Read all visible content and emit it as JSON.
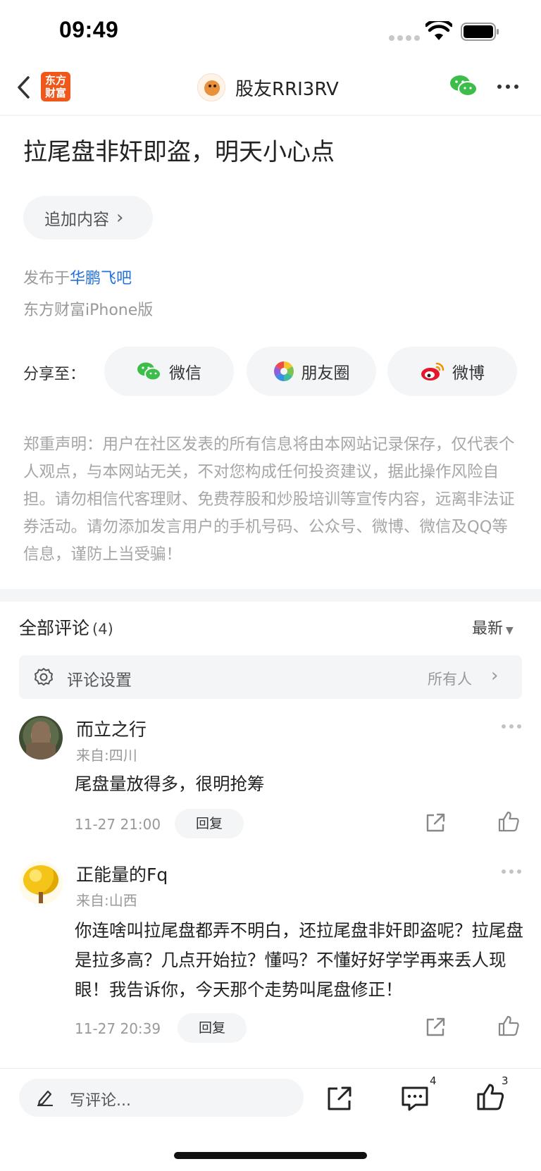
{
  "status_bar": {
    "time": "09:49"
  },
  "nav": {
    "app_logo": "东方财富",
    "title": "股友RRI3RV"
  },
  "post": {
    "title": "拉尾盘非奸即盗，明天小心点",
    "append_label": "追加内容",
    "published_prefix": "发布于",
    "published_bar": "华鹏飞吧",
    "device": "东方财富iPhone版"
  },
  "share": {
    "label": "分享至：",
    "wechat": "微信",
    "moments": "朋友圈",
    "weibo": "微博"
  },
  "disclaimer": "郑重声明：用户在社区发表的所有信息将由本网站记录保存，仅代表个人观点，与本网站无关，不对您构成任何投资建议，据此操作风险自担。请勿相信代客理财、免费荐股和炒股培训等宣传内容，远离非法证券活动。请勿添加发言用户的手机号码、公众号、微博、微信及QQ等信息，谨防上当受骗！",
  "comments": {
    "title": "全部评论",
    "count": "(4)",
    "sort": "最新",
    "setting_label": "评论设置",
    "setting_value": "所有人",
    "items": [
      {
        "name": "而立之行",
        "location": "来自:四川",
        "body": "尾盘量放得多，很明抢筹",
        "time": "11-27 21:00",
        "reply": "回复"
      },
      {
        "name": "正能量的Fq",
        "location": "来自:山西",
        "body": "你连啥叫拉尾盘都弄不明白，还拉尾盘非奸即盗呢？拉尾盘是拉多高？几点开始拉？懂吗？不懂好好学学再来丢人现眼！我告诉你，今天那个走势叫尾盘修正！",
        "time": "11-27 20:39",
        "reply": "回复"
      }
    ]
  },
  "bottom_bar": {
    "write_placeholder": "写评论...",
    "comment_count": "4",
    "like_count": "3"
  },
  "colors": {
    "brand_orange": "#f0571a",
    "link_blue": "#2371d8",
    "wechat_green": "#3dbd4a",
    "weibo_red": "#e6162d"
  }
}
